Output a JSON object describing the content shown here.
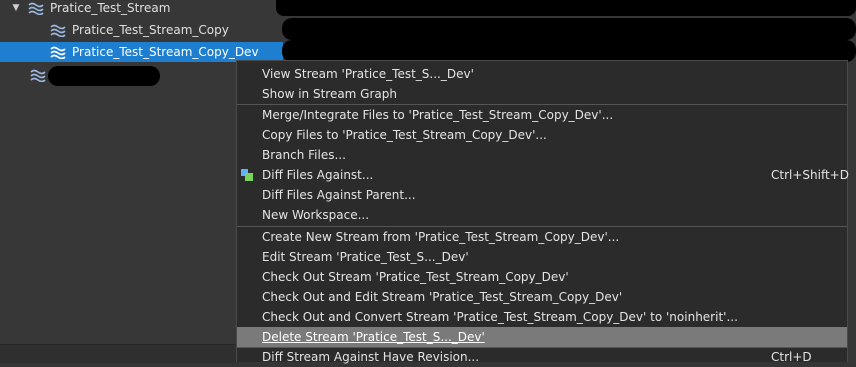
{
  "tree": {
    "items": [
      {
        "label": "Pratice_Test_Stream",
        "expanded": true
      },
      {
        "label": "Pratice_Test_Stream_Copy"
      },
      {
        "label": "Pratice_Test_Stream_Copy_Dev",
        "selected": true
      },
      {
        "label": ""
      }
    ]
  },
  "menu": {
    "items": [
      {
        "label": "View Stream 'Pratice_Test_S..._Dev'",
        "shortcut": ""
      },
      {
        "label": "Show in Stream Graph",
        "shortcut": ""
      },
      {
        "label": "Merge/Integrate Files to 'Pratice_Test_Stream_Copy_Dev'...",
        "shortcut": ""
      },
      {
        "label": "Copy Files to 'Pratice_Test_Stream_Copy_Dev'...",
        "shortcut": ""
      },
      {
        "label": "Branch Files...",
        "shortcut": ""
      },
      {
        "label": "Diff Files Against...",
        "shortcut": "Ctrl+Shift+D",
        "icon": "diff-icon"
      },
      {
        "label": "Diff Files Against Parent...",
        "shortcut": ""
      },
      {
        "label": "New Workspace...",
        "shortcut": ""
      },
      {
        "label": "Create New Stream from 'Pratice_Test_Stream_Copy_Dev'...",
        "shortcut": ""
      },
      {
        "label": "Edit Stream 'Pratice_Test_S..._Dev'",
        "shortcut": ""
      },
      {
        "label": "Check Out Stream 'Pratice_Test_Stream_Copy_Dev'",
        "shortcut": ""
      },
      {
        "label": "Check Out and Edit Stream 'Pratice_Test_Stream_Copy_Dev'",
        "shortcut": ""
      },
      {
        "label": "Check Out and Convert Stream 'Pratice_Test_Stream_Copy_Dev' to 'noinherit'...",
        "shortcut": ""
      },
      {
        "label": "Delete Stream 'Pratice_Test_S..._Dev'",
        "shortcut": "",
        "highlighted": true
      },
      {
        "label": "Diff Stream Against Have Revision...",
        "shortcut": "Ctrl+D"
      }
    ]
  },
  "colors": {
    "selection": "#1e7fd0",
    "menu_bg": "#2b2b2b",
    "menu_highlight": "#7a7a7a",
    "tree_bg": "#373737"
  }
}
